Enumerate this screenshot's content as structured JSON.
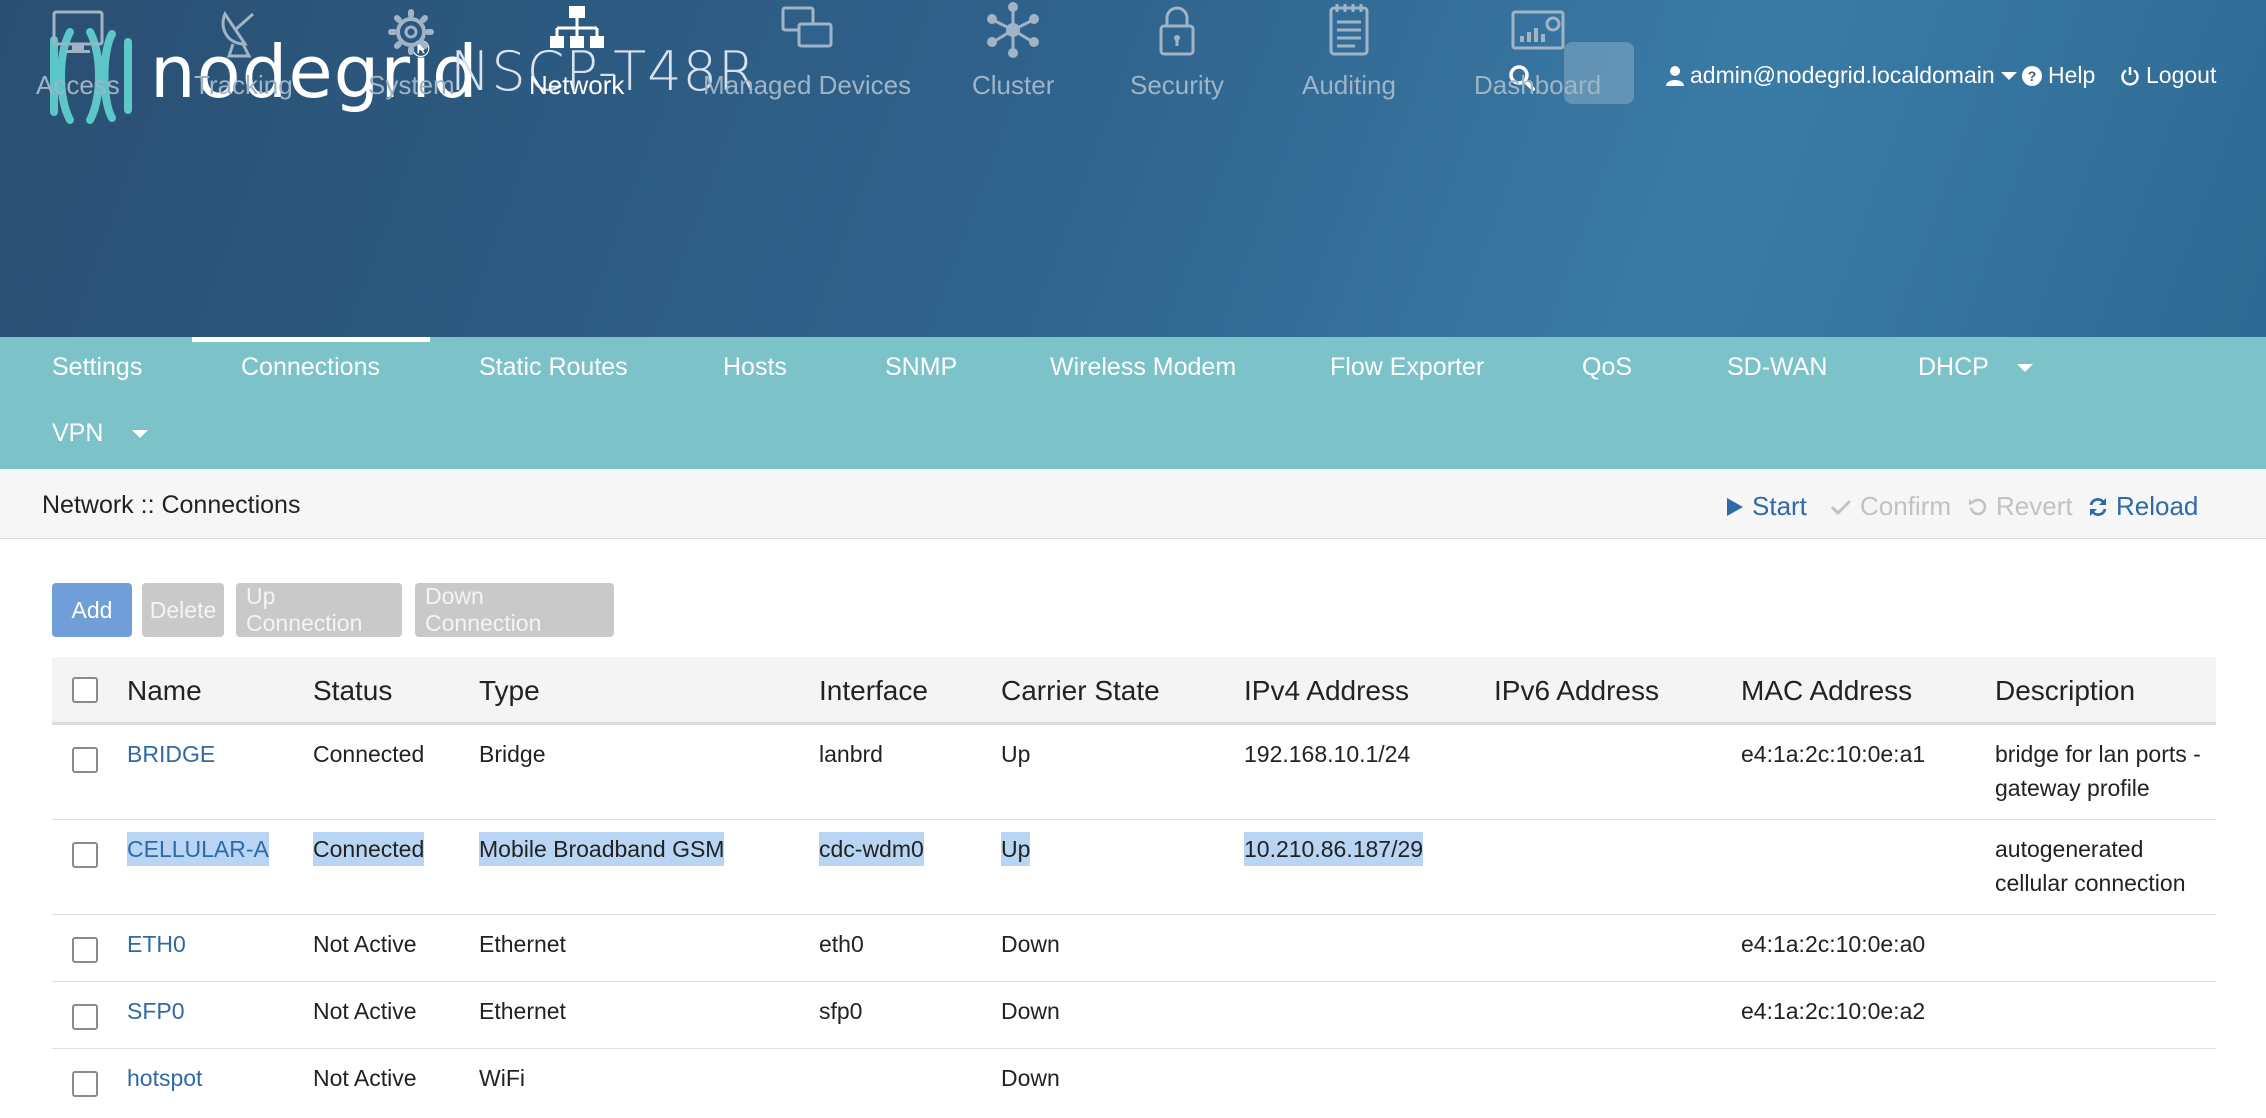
{
  "header": {
    "brand": "nodegrid",
    "registered": "®",
    "model": "NSCP-T48R",
    "user": "admin@nodegrid.localdomain",
    "help": "Help",
    "logout": "Logout"
  },
  "main_nav": [
    {
      "label": "Access",
      "icon": "monitor-icon"
    },
    {
      "label": "Tracking",
      "icon": "satellite-dish-icon"
    },
    {
      "label": "System",
      "icon": "gear-icon"
    },
    {
      "label": "Network",
      "icon": "network-icon",
      "active": true
    },
    {
      "label": "Managed Devices",
      "icon": "devices-icon"
    },
    {
      "label": "Cluster",
      "icon": "cluster-icon"
    },
    {
      "label": "Security",
      "icon": "lock-icon"
    },
    {
      "label": "Auditing",
      "icon": "notepad-icon"
    },
    {
      "label": "Dashboard",
      "icon": "dashboard-icon"
    }
  ],
  "sub_nav": [
    {
      "label": "Settings"
    },
    {
      "label": "Connections",
      "active": true
    },
    {
      "label": "Static Routes"
    },
    {
      "label": "Hosts"
    },
    {
      "label": "SNMP"
    },
    {
      "label": "Wireless Modem"
    },
    {
      "label": "Flow Exporter"
    },
    {
      "label": "QoS"
    },
    {
      "label": "SD-WAN"
    },
    {
      "label": "DHCP",
      "dropdown": true
    },
    {
      "label": "VPN",
      "dropdown": true
    }
  ],
  "breadcrumb": "Network :: Connections",
  "page_actions": {
    "start": "Start",
    "confirm": "Confirm",
    "revert": "Revert",
    "reload": "Reload"
  },
  "buttons": {
    "add": "Add",
    "delete": "Delete",
    "up": "Up Connection",
    "down": "Down Connection"
  },
  "table": {
    "columns": [
      "Name",
      "Status",
      "Type",
      "Interface",
      "Carrier State",
      "IPv4 Address",
      "IPv6 Address",
      "MAC Address",
      "Description"
    ],
    "rows": [
      {
        "name": "BRIDGE",
        "status": "Connected",
        "type": "Bridge",
        "interface": "lanbrd",
        "carrier": "Up",
        "ipv4": "192.168.10.1/24",
        "ipv6": "",
        "mac": "e4:1a:2c:10:0e:a1",
        "desc1": "bridge for lan ports -",
        "desc2": "gateway profile"
      },
      {
        "name": "CELLULAR-A",
        "status": "Connected",
        "type": "Mobile Broadband GSM",
        "interface": "cdc-wdm0",
        "carrier": "Up",
        "ipv4": "10.210.86.187/29",
        "ipv6": "",
        "mac": "",
        "desc1": "autogenerated",
        "desc2": "cellular connection",
        "highlighted": true
      },
      {
        "name": "ETH0",
        "status": "Not Active",
        "type": "Ethernet",
        "interface": "eth0",
        "carrier": "Down",
        "ipv4": "",
        "ipv6": "",
        "mac": "e4:1a:2c:10:0e:a0",
        "desc1": "",
        "desc2": ""
      },
      {
        "name": "SFP0",
        "status": "Not Active",
        "type": "Ethernet",
        "interface": "sfp0",
        "carrier": "Down",
        "ipv4": "",
        "ipv6": "",
        "mac": "e4:1a:2c:10:0e:a2",
        "desc1": "",
        "desc2": ""
      },
      {
        "name": "hotspot",
        "status": "Not Active",
        "type": "WiFi",
        "interface": "",
        "carrier": "Down",
        "ipv4": "",
        "ipv6": "",
        "mac": "",
        "desc1": "",
        "desc2": ""
      }
    ]
  },
  "colors": {
    "header": "#2f628c",
    "subnav": "#7cc3c9",
    "link": "#2f6aa6",
    "primary_button": "#6f9ed8",
    "disabled_button": "#c9c9c9",
    "highlight": "#b9d5f4"
  }
}
